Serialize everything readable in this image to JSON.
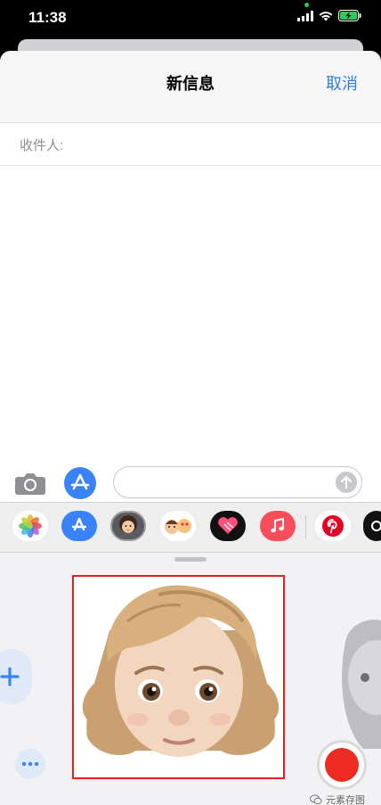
{
  "status_bar": {
    "time": "11:38",
    "battery_level": "charging"
  },
  "nav": {
    "title": "新信息",
    "cancel": "取消"
  },
  "recipient": {
    "label": "收件人:"
  },
  "input": {
    "placeholder": ""
  },
  "app_drawer": {
    "apps": [
      "photos-icon",
      "app-store-icon",
      "memoji-icon",
      "memoji-stickers-icon",
      "digital-touch-icon",
      "music-icon",
      "pinterest-icon",
      "tiktok-icon"
    ]
  },
  "memoji_panel": {
    "selected": "memoji-woman-curly-hair"
  },
  "watermark": {
    "text": "元素存图"
  },
  "colors": {
    "accent": "#2f7fd6",
    "record": "#ec2c22",
    "highlight": "#e2231a"
  }
}
